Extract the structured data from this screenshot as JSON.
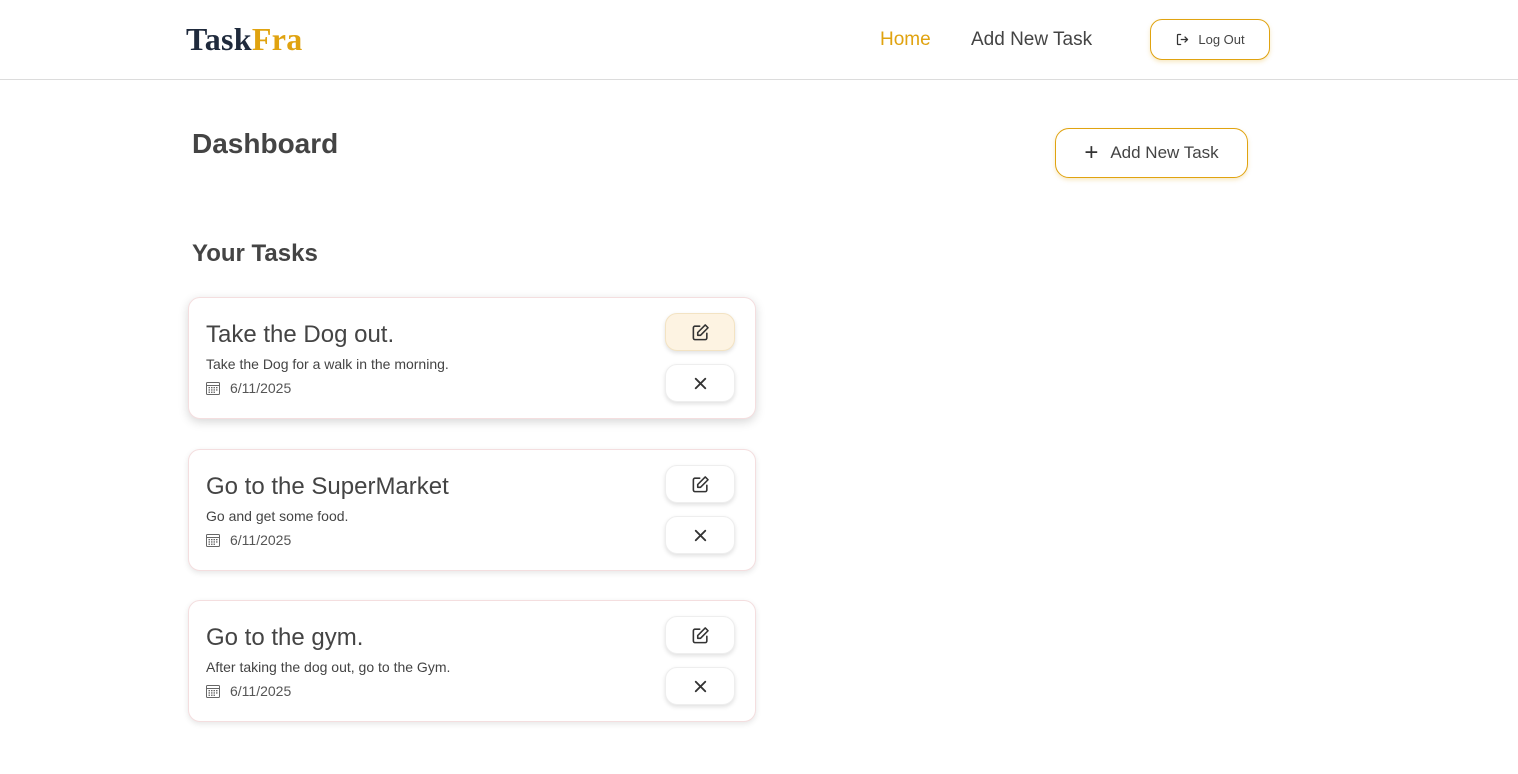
{
  "logo": {
    "part1": "Task",
    "part2": "Fra"
  },
  "nav": {
    "home": "Home",
    "add_task": "Add New Task",
    "logout": "Log Out"
  },
  "dashboard": {
    "title": "Dashboard",
    "add_button": "Add New Task",
    "section_title": "Your Tasks"
  },
  "tasks": [
    {
      "title": "Take the Dog out.",
      "description": "Take the Dog for a walk in the morning.",
      "date": "6/11/2025"
    },
    {
      "title": "Go to the SuperMarket",
      "description": "Go and get some food.",
      "date": "6/11/2025"
    },
    {
      "title": "Go to the gym.",
      "description": "After taking the dog out, go to the Gym.",
      "date": "6/11/2025"
    }
  ],
  "colors": {
    "accent": "#e0a310",
    "logo_dark": "#1f2a3c",
    "text": "#444444"
  },
  "icons": {
    "logout": "logout-icon",
    "add": "plus-icon",
    "edit": "edit-icon",
    "delete": "close-icon",
    "date": "calendar-icon"
  }
}
